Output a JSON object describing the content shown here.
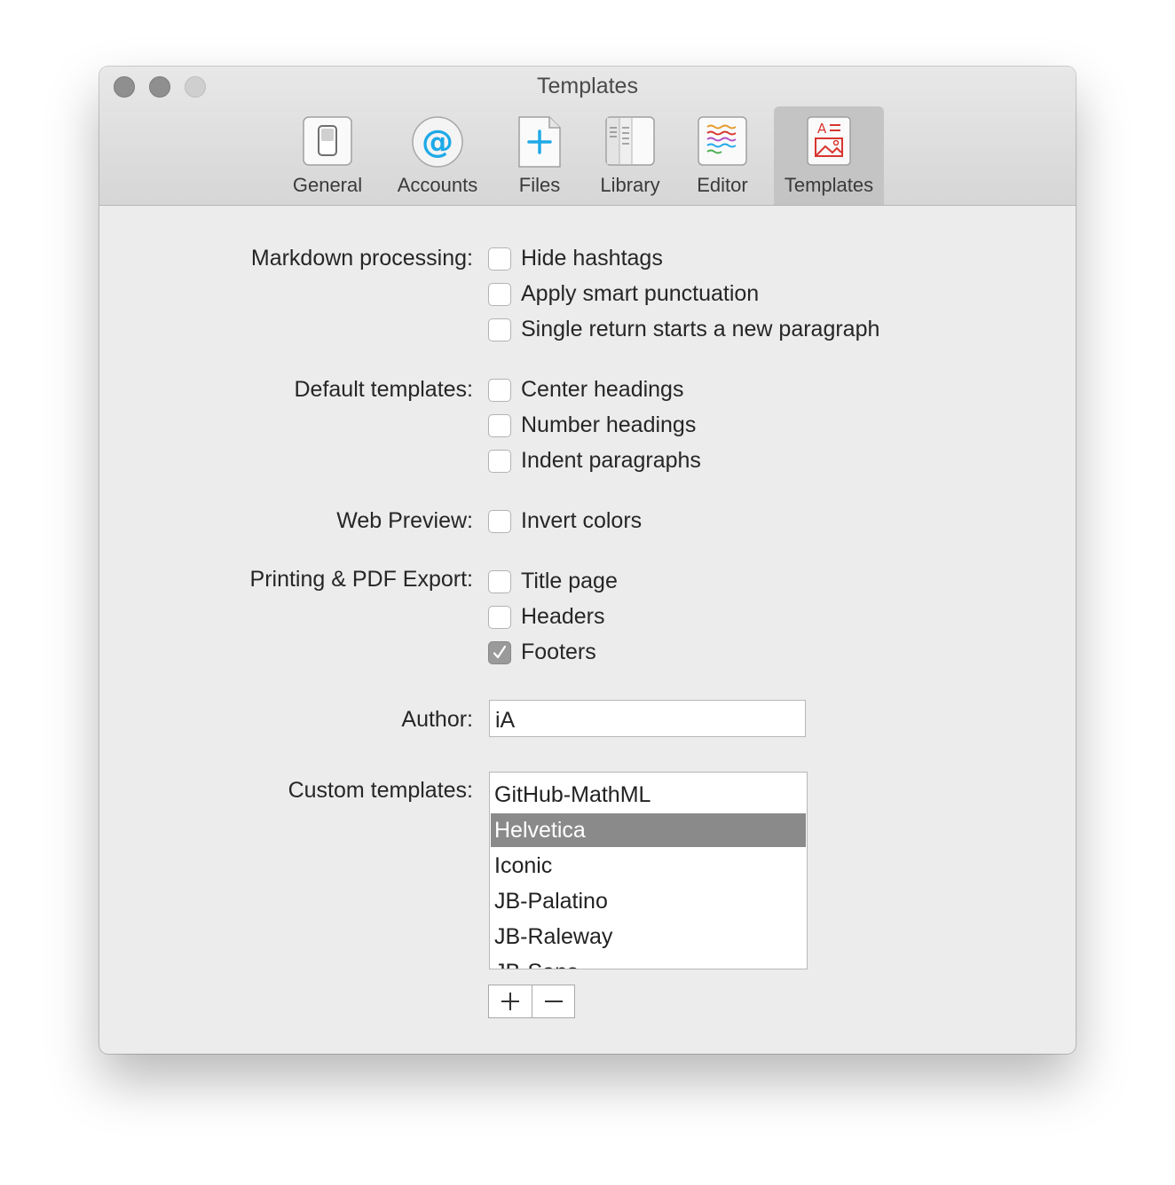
{
  "window": {
    "title": "Templates"
  },
  "toolbar": {
    "tabs": [
      {
        "label": "General",
        "icon": "switch-icon"
      },
      {
        "label": "Accounts",
        "icon": "at-sign-icon"
      },
      {
        "label": "Files",
        "icon": "new-file-icon"
      },
      {
        "label": "Library",
        "icon": "library-icon"
      },
      {
        "label": "Editor",
        "icon": "editor-lines-icon"
      },
      {
        "label": "Templates",
        "icon": "template-icon",
        "selected": true
      }
    ]
  },
  "markdown": {
    "label": "Markdown processing:",
    "options": [
      {
        "label": "Hide hashtags",
        "checked": false
      },
      {
        "label": "Apply smart punctuation",
        "checked": false
      },
      {
        "label": "Single return starts a new paragraph",
        "checked": false
      }
    ]
  },
  "default_templates": {
    "label": "Default templates:",
    "options": [
      {
        "label": "Center headings",
        "checked": false
      },
      {
        "label": "Number headings",
        "checked": false
      },
      {
        "label": "Indent paragraphs",
        "checked": false
      }
    ]
  },
  "web_preview": {
    "label": "Web Preview:",
    "options": [
      {
        "label": "Invert colors",
        "checked": false
      }
    ]
  },
  "printing": {
    "label": "Printing & PDF Export:",
    "options": [
      {
        "label": "Title page",
        "checked": false
      },
      {
        "label": "Headers",
        "checked": false
      },
      {
        "label": "Footers",
        "checked": true
      }
    ]
  },
  "author": {
    "label": "Author:",
    "value": "iA"
  },
  "custom_templates": {
    "label": "Custom templates:",
    "items": [
      "GitHub-MathML",
      "Helvetica",
      "Iconic",
      "JB-Palatino",
      "JB-Raleway",
      "JB-Sans"
    ],
    "selected": "Helvetica"
  },
  "colors": {
    "accent_blue": "#1fa9e8",
    "template_red": "#d8362f",
    "selection_gray": "#8a8a8a"
  }
}
